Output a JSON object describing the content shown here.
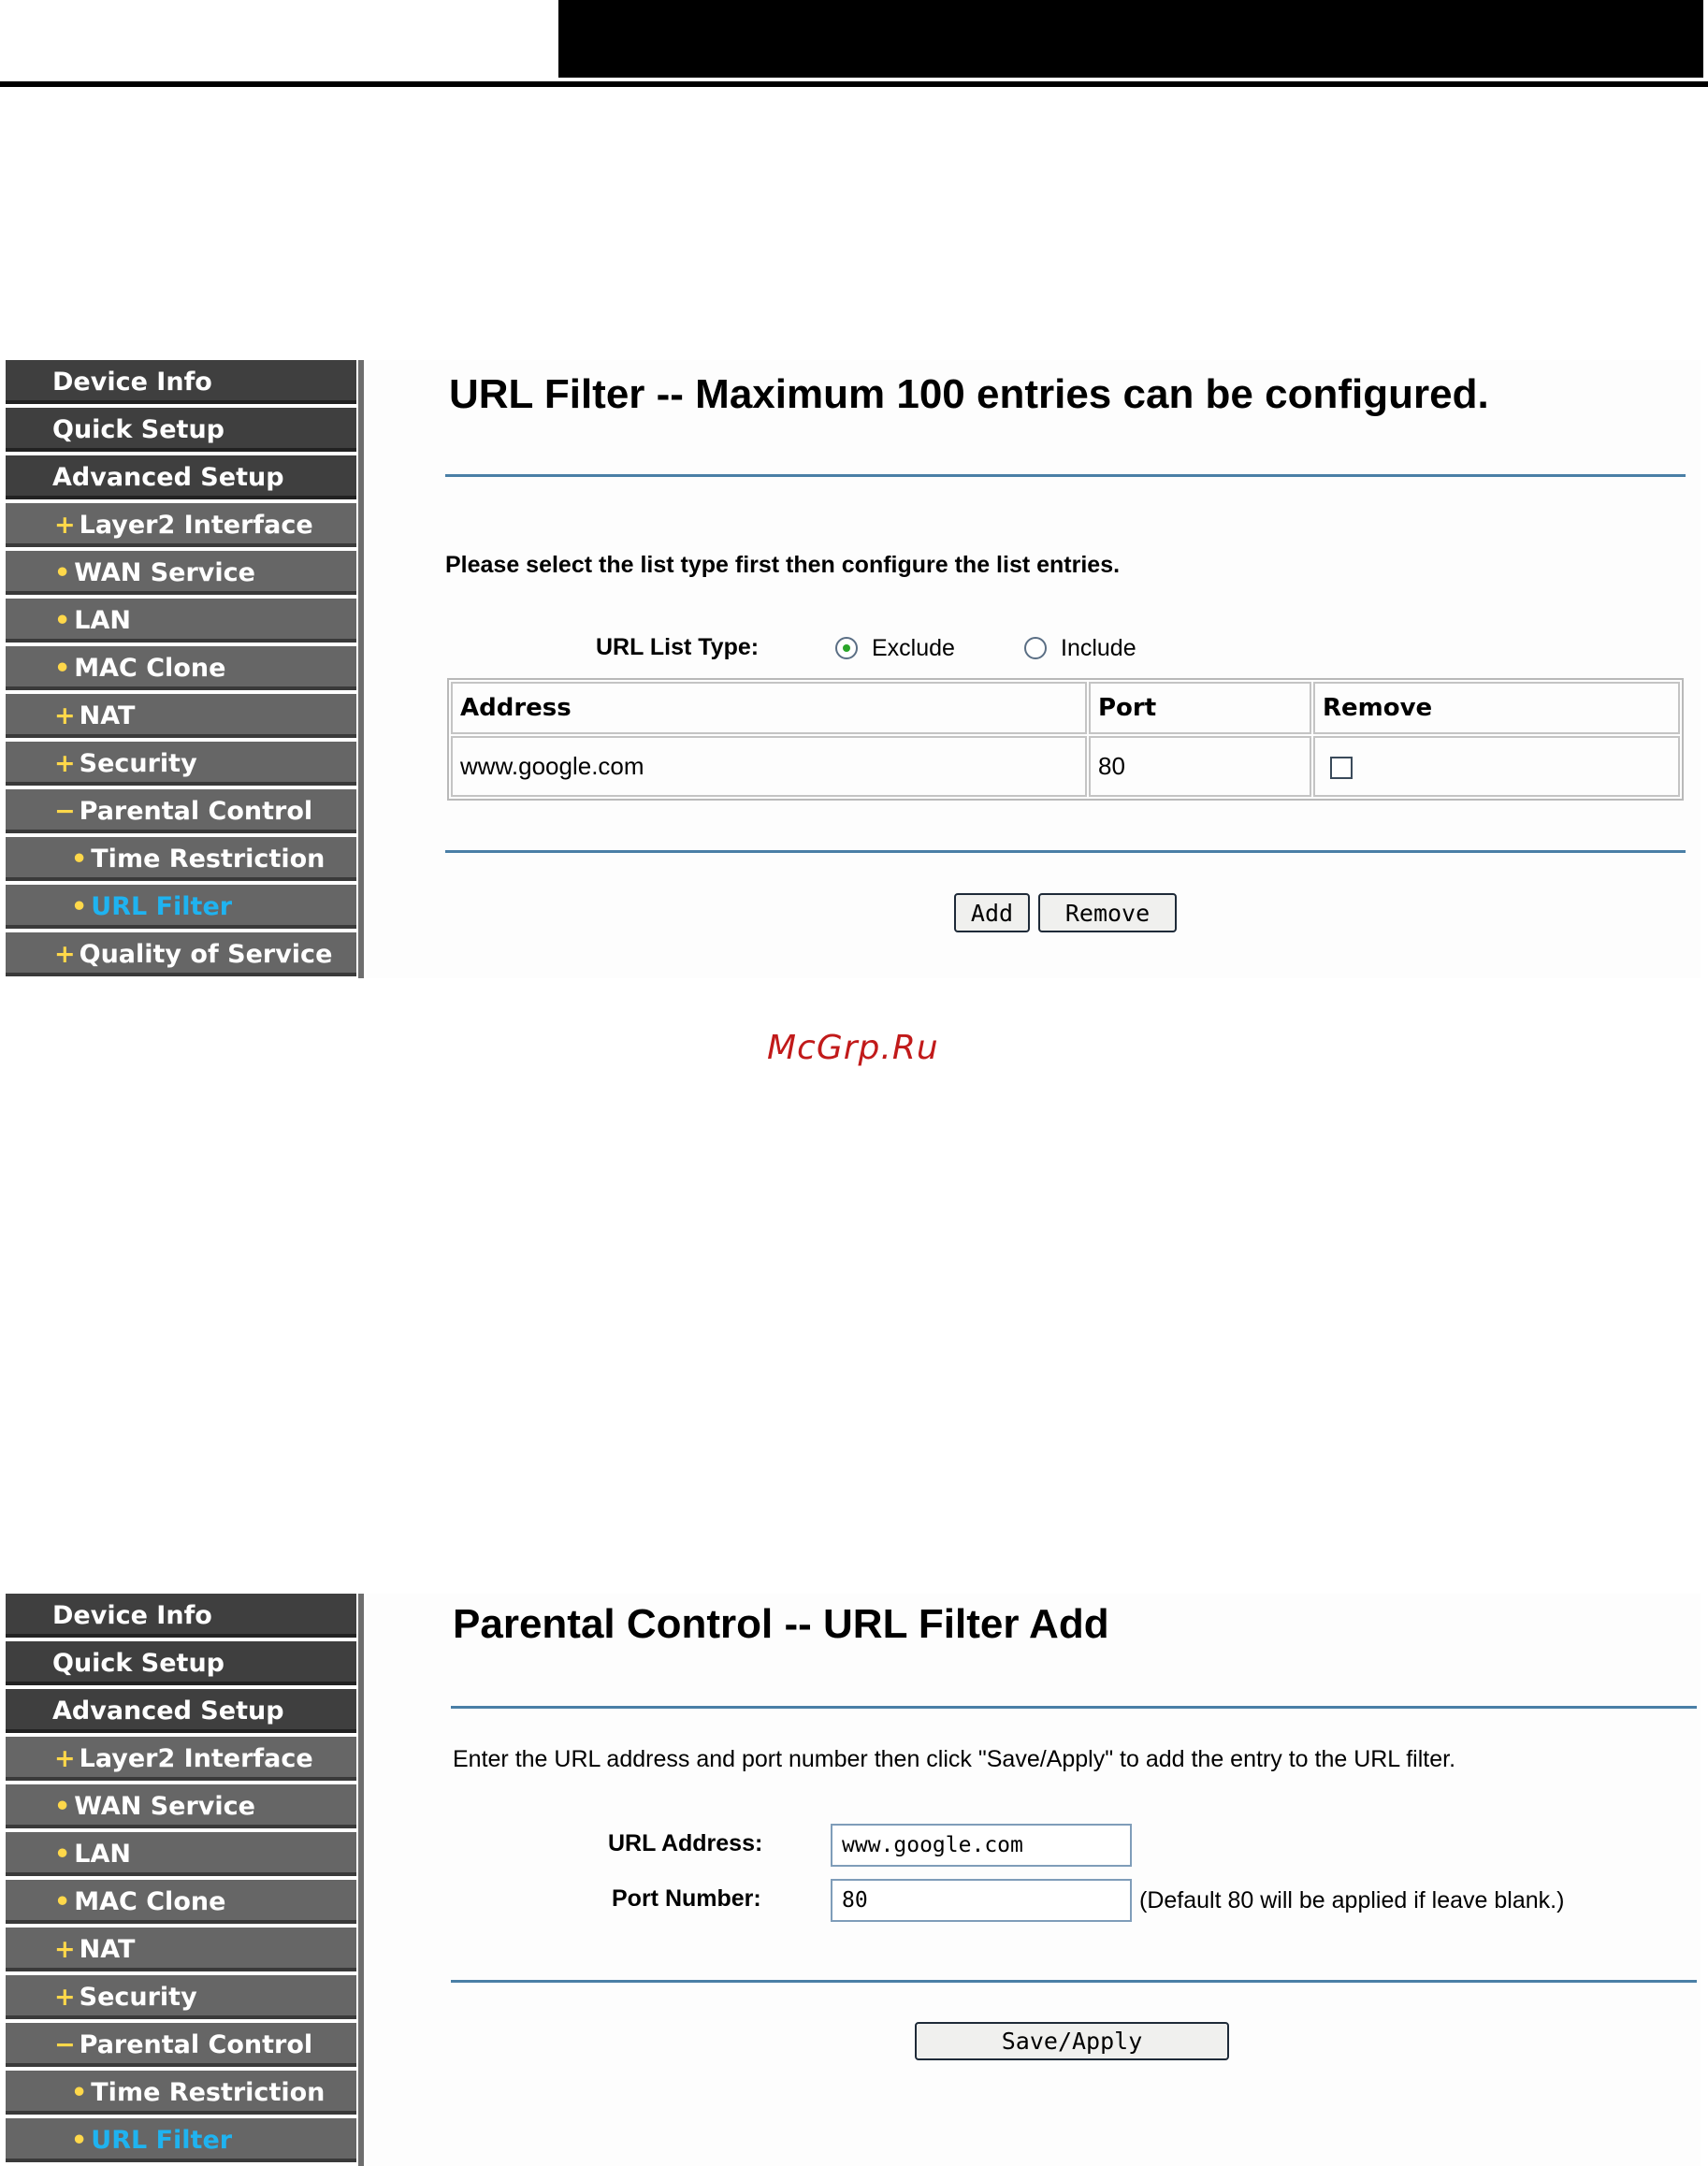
{
  "watermark": "McGrp.Ru",
  "sidebar": {
    "items": [
      {
        "label": "Device Info",
        "level": "top"
      },
      {
        "label": "Quick Setup",
        "level": "top"
      },
      {
        "label": "Advanced Setup",
        "level": "top"
      },
      {
        "label": "Layer2 Interface",
        "level": "sub",
        "marker": "+"
      },
      {
        "label": "WAN Service",
        "level": "sub",
        "marker": "•"
      },
      {
        "label": "LAN",
        "level": "sub",
        "marker": "•"
      },
      {
        "label": "MAC Clone",
        "level": "sub",
        "marker": "•"
      },
      {
        "label": "NAT",
        "level": "sub",
        "marker": "+"
      },
      {
        "label": "Security",
        "level": "sub",
        "marker": "+"
      },
      {
        "label": "Parental Control",
        "level": "sub",
        "marker": "−"
      },
      {
        "label": "Time Restriction",
        "level": "sub2",
        "marker": "•"
      },
      {
        "label": "URL Filter",
        "level": "sub2",
        "marker": "•",
        "active": true
      },
      {
        "label": "Quality of Service",
        "level": "sub",
        "marker": "+"
      }
    ],
    "active_color": "#1fb3f0",
    "marker_color": "#ffd84a"
  },
  "panel1": {
    "title": "URL Filter -- Maximum 100 entries can be configured.",
    "instruction": "Please select the list type first then configure the list entries.",
    "list_type_label": "URL List Type:",
    "options": [
      {
        "label": "Exclude",
        "checked": true
      },
      {
        "label": "Include",
        "checked": false
      }
    ],
    "table": {
      "headers": [
        "Address",
        "Port",
        "Remove"
      ],
      "rows": [
        {
          "address": "www.google.com",
          "port": "80",
          "remove": false
        }
      ]
    },
    "buttons": {
      "add": "Add",
      "remove": "Remove"
    }
  },
  "panel2": {
    "title": "Parental Control -- URL Filter Add",
    "instruction": "Enter the URL address and port number then click \"Save/Apply\" to add the entry to the URL filter.",
    "url_label": "URL Address:",
    "url_value": "www.google.com",
    "port_label": "Port Number:",
    "port_value": "80",
    "port_hint": "(Default 80 will be applied if leave blank.)",
    "save_button": "Save/Apply"
  }
}
